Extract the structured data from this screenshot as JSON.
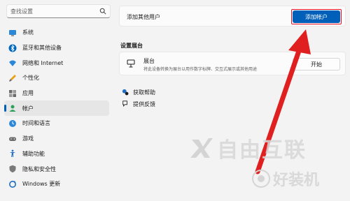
{
  "sidebar": {
    "search_placeholder": "查找设置",
    "items": [
      {
        "label": "系统",
        "icon": "monitor-icon"
      },
      {
        "label": "蓝牙和其他设备",
        "icon": "bluetooth-icon"
      },
      {
        "label": "网络和 Internet",
        "icon": "wifi-icon"
      },
      {
        "label": "个性化",
        "icon": "brush-icon"
      },
      {
        "label": "应用",
        "icon": "apps-icon"
      },
      {
        "label": "帐户",
        "icon": "person-icon",
        "active": true
      },
      {
        "label": "时间和语言",
        "icon": "globe-clock-icon"
      },
      {
        "label": "游戏",
        "icon": "gamepad-icon"
      },
      {
        "label": "辅助功能",
        "icon": "accessibility-icon"
      },
      {
        "label": "隐私和安全性",
        "icon": "shield-icon"
      },
      {
        "label": "Windows 更新",
        "icon": "update-icon"
      }
    ]
  },
  "main": {
    "add_other_user_label": "添加其他用户",
    "add_account_button": "添加帐户",
    "kiosk_section_title": "设置展台",
    "kiosk": {
      "title": "展台",
      "description": "将此设备转换为展台以用作数字标牌、交互式展示或其他用途",
      "start_button": "开始"
    },
    "links": {
      "get_help": "获取帮助",
      "feedback": "提供反馈"
    }
  },
  "watermarks": {
    "brand": "自由互联",
    "brand2": "好装机"
  },
  "colors": {
    "accent": "#005fb8",
    "highlight": "#e81123",
    "background": "#f3f3f3"
  }
}
